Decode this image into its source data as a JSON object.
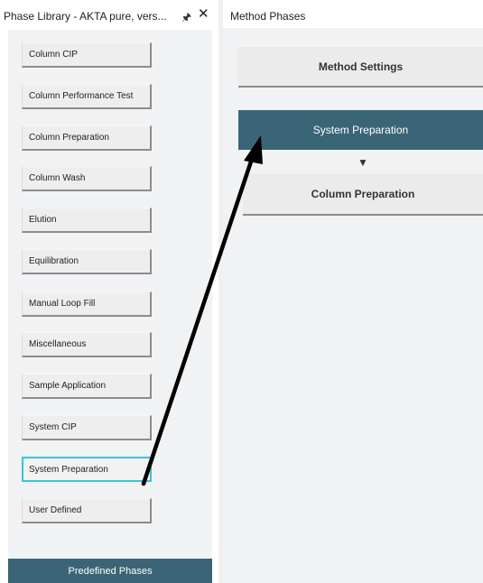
{
  "left_panel": {
    "title": "Phase Library - AKTA pure, vers...",
    "pin_icon": "pin-icon",
    "close_glyph": "✕",
    "items": [
      {
        "label": "Column CIP"
      },
      {
        "label": "Column Performance Test"
      },
      {
        "label": "Column Preparation"
      },
      {
        "label": "Column Wash"
      },
      {
        "label": "Elution"
      },
      {
        "label": "Equilibration"
      },
      {
        "label": "Manual Loop Fill"
      },
      {
        "label": "Miscellaneous"
      },
      {
        "label": "Sample Application"
      },
      {
        "label": "System CIP"
      },
      {
        "label": "System Preparation",
        "selected": true
      },
      {
        "label": "User Defined"
      }
    ],
    "bottom_tab": "Predefined Phases"
  },
  "right_panel": {
    "title": "Method Phases",
    "method_settings": "Method Settings",
    "phases": [
      "System Preparation",
      "Column Preparation"
    ],
    "arrow_glyph": "▼"
  },
  "colors": {
    "selected_phase_bg": "#3a6577",
    "selected_item_border": "#39c4d8",
    "tab_bg": "#3b6576",
    "annotation_arrow": "#000000"
  }
}
